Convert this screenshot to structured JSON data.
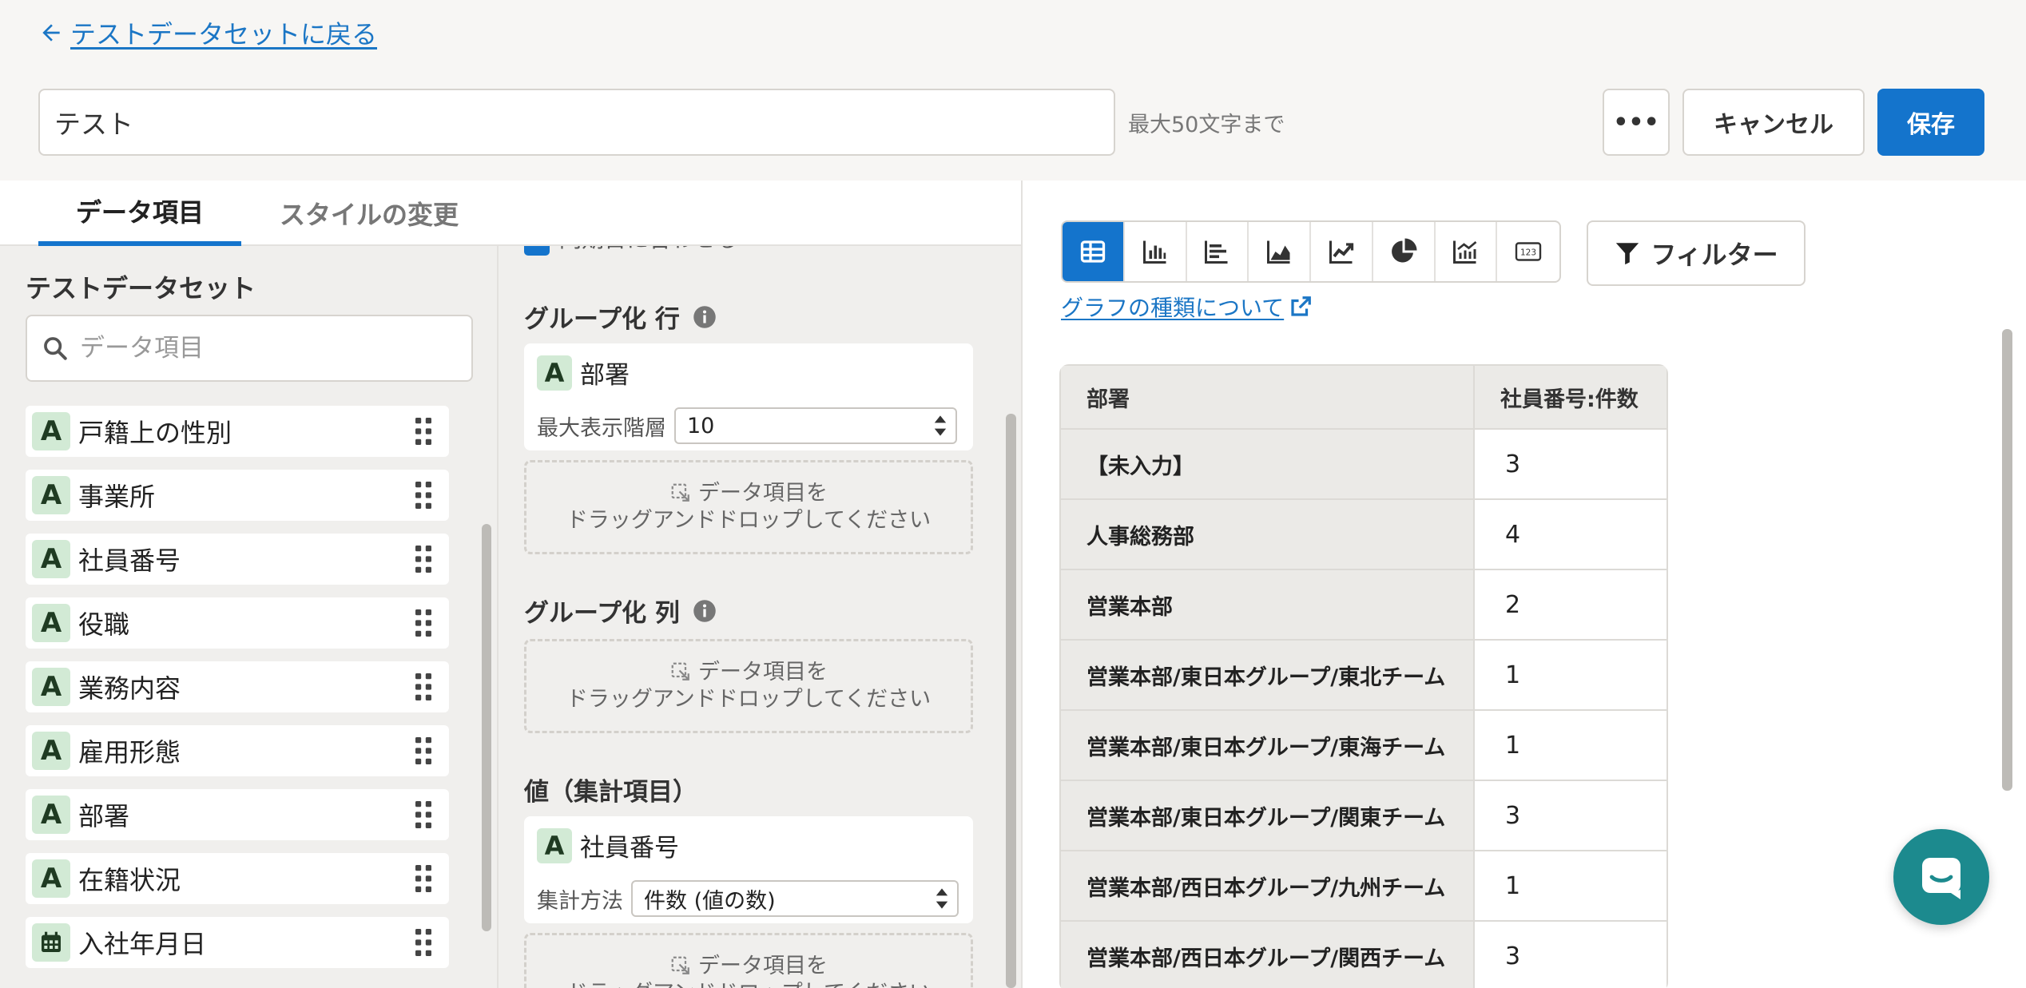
{
  "header": {
    "back_label": "テストデータセットに戻る",
    "name_value": "テスト",
    "name_hint": "最大50文字まで",
    "more_label": "•••",
    "cancel_label": "キャンセル",
    "save_label": "保存"
  },
  "tabs": [
    {
      "label": "データ項目",
      "active": true
    },
    {
      "label": "スタイルの変更",
      "active": false
    }
  ],
  "field_panel": {
    "dataset_title": "テストデータセット",
    "search_placeholder": "データ項目",
    "items": [
      {
        "label": "戸籍上の性別",
        "type": "A"
      },
      {
        "label": "事業所",
        "type": "A"
      },
      {
        "label": "社員番号",
        "type": "A"
      },
      {
        "label": "役職",
        "type": "A"
      },
      {
        "label": "業務内容",
        "type": "A"
      },
      {
        "label": "雇用形態",
        "type": "A"
      },
      {
        "label": "部署",
        "type": "A"
      },
      {
        "label": "在籍状況",
        "type": "A"
      },
      {
        "label": "入社年月日",
        "type": "calendar-icon"
      }
    ]
  },
  "config": {
    "cut_option_text": "同期日に合わせる",
    "rows": {
      "title": "グループ化 行",
      "field": {
        "type": "A",
        "name": "部署"
      },
      "sub_label": "最大表示階層",
      "sub_value": "10"
    },
    "columns": {
      "title": "グループ化 列"
    },
    "values": {
      "title": "値（集計項目）",
      "field": {
        "type": "A",
        "name": "社員番号"
      },
      "sub_label": "集計方法",
      "sub_value": "件数 (値の数)"
    },
    "dropzone": {
      "line1": "データ項目を",
      "line2": "ドラッグアンドドロップしてください"
    }
  },
  "chart_toolbar": {
    "buttons": [
      {
        "icon": "table-icon",
        "active": true
      },
      {
        "icon": "bar-chart-icon",
        "active": false
      },
      {
        "icon": "horizontal-bar-icon",
        "active": false
      },
      {
        "icon": "area-chart-icon",
        "active": false
      },
      {
        "icon": "line-chart-icon",
        "active": false
      },
      {
        "icon": "pie-chart-icon",
        "active": false
      },
      {
        "icon": "combo-chart-icon",
        "active": false
      },
      {
        "icon": "number-icon",
        "active": false
      }
    ],
    "filter_label": "フィルター",
    "chart_type_link": "グラフの種類について"
  },
  "result_table": {
    "headers": [
      "部署",
      "社員番号:件数"
    ],
    "rows": [
      [
        "【未入力】",
        "3"
      ],
      [
        "人事総務部",
        "4"
      ],
      [
        "営業本部",
        "2"
      ],
      [
        "営業本部/東日本グループ/東北チーム",
        "1"
      ],
      [
        "営業本部/東日本グループ/東海チーム",
        "1"
      ],
      [
        "営業本部/東日本グループ/関東チーム",
        "3"
      ],
      [
        "営業本部/西日本グループ/九州チーム",
        "1"
      ],
      [
        "営業本部/西日本グループ/関西チーム",
        "3"
      ]
    ]
  },
  "colors": {
    "accent": "#1474cc",
    "badge_bg": "#d2ead5",
    "chat": "#1c8a8e"
  }
}
